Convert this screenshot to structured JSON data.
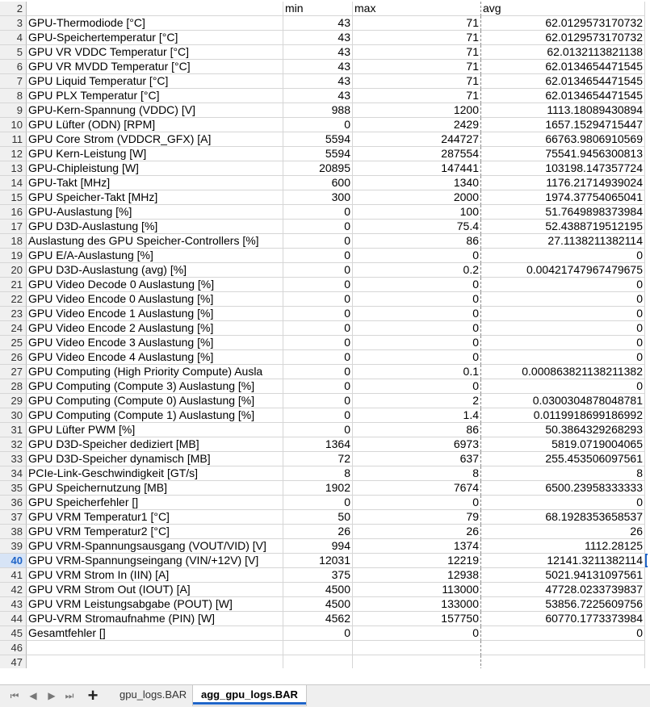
{
  "header_row": {
    "row": "2",
    "a": "",
    "b": "min",
    "c": "max",
    "d": "avg"
  },
  "rows": [
    {
      "row": "3",
      "name": "GPU-Thermodiode [°C]",
      "min": "43",
      "max": "71",
      "avg": "62.0129573170732"
    },
    {
      "row": "4",
      "name": "GPU-Speichertemperatur [°C]",
      "min": "43",
      "max": "71",
      "avg": "62.0129573170732"
    },
    {
      "row": "5",
      "name": "GPU VR VDDC Temperatur [°C]",
      "min": "43",
      "max": "71",
      "avg": "62.0132113821138"
    },
    {
      "row": "6",
      "name": "GPU VR MVDD Temperatur [°C]",
      "min": "43",
      "max": "71",
      "avg": "62.0134654471545"
    },
    {
      "row": "7",
      "name": "GPU Liquid Temperatur [°C]",
      "min": "43",
      "max": "71",
      "avg": "62.0134654471545"
    },
    {
      "row": "8",
      "name": "GPU PLX Temperatur [°C]",
      "min": "43",
      "max": "71",
      "avg": "62.0134654471545"
    },
    {
      "row": "9",
      "name": "GPU-Kern-Spannung (VDDC) [V]",
      "min": "988",
      "max": "1200",
      "avg": "1113.18089430894"
    },
    {
      "row": "10",
      "name": "GPU Lüfter (ODN) [RPM]",
      "min": "0",
      "max": "2429",
      "avg": "1657.15294715447"
    },
    {
      "row": "11",
      "name": "GPU Core Strom (VDDCR_GFX) [A]",
      "min": "5594",
      "max": "244727",
      "avg": "66763.9806910569"
    },
    {
      "row": "12",
      "name": "GPU Kern-Leistung [W]",
      "min": "5594",
      "max": "287554",
      "avg": "75541.9456300813"
    },
    {
      "row": "13",
      "name": "GPU-Chipleistung [W]",
      "min": "20895",
      "max": "147441",
      "avg": "103198.147357724"
    },
    {
      "row": "14",
      "name": "GPU-Takt [MHz]",
      "min": "600",
      "max": "1340",
      "avg": "1176.21714939024"
    },
    {
      "row": "15",
      "name": "GPU Speicher-Takt [MHz]",
      "min": "300",
      "max": "2000",
      "avg": "1974.37754065041"
    },
    {
      "row": "16",
      "name": "GPU-Auslastung [%]",
      "min": "0",
      "max": "100",
      "avg": "51.7649898373984"
    },
    {
      "row": "17",
      "name": "GPU D3D-Auslastung [%]",
      "min": "0",
      "max": "75.4",
      "avg": "52.4388719512195"
    },
    {
      "row": "18",
      "name": "Auslastung des GPU Speicher-Controllers [%]",
      "min": "0",
      "max": "86",
      "avg": "27.1138211382114"
    },
    {
      "row": "19",
      "name": "GPU E/A-Auslastung [%]",
      "min": "0",
      "max": "0",
      "avg": "0"
    },
    {
      "row": "20",
      "name": "GPU D3D-Auslastung (avg) [%]",
      "min": "0",
      "max": "0.2",
      "avg": "0.00421747967479675"
    },
    {
      "row": "21",
      "name": "GPU Video Decode 0 Auslastung [%]",
      "min": "0",
      "max": "0",
      "avg": "0"
    },
    {
      "row": "22",
      "name": "GPU Video Encode 0 Auslastung [%]",
      "min": "0",
      "max": "0",
      "avg": "0"
    },
    {
      "row": "23",
      "name": "GPU Video Encode 1 Auslastung [%]",
      "min": "0",
      "max": "0",
      "avg": "0"
    },
    {
      "row": "24",
      "name": "GPU Video Encode 2 Auslastung [%]",
      "min": "0",
      "max": "0",
      "avg": "0"
    },
    {
      "row": "25",
      "name": "GPU Video Encode 3 Auslastung [%]",
      "min": "0",
      "max": "0",
      "avg": "0"
    },
    {
      "row": "26",
      "name": "GPU Video Encode 4 Auslastung [%]",
      "min": "0",
      "max": "0",
      "avg": "0"
    },
    {
      "row": "27",
      "name": "GPU Computing (High Priority Compute) Ausla",
      "min": "0",
      "max": "0.1",
      "avg": "0.000863821138211382"
    },
    {
      "row": "28",
      "name": "GPU Computing (Compute 3) Auslastung [%]",
      "min": "0",
      "max": "0",
      "avg": "0"
    },
    {
      "row": "29",
      "name": "GPU Computing (Compute 0) Auslastung [%]",
      "min": "0",
      "max": "2",
      "avg": "0.0300304878048781"
    },
    {
      "row": "30",
      "name": "GPU Computing (Compute 1) Auslastung [%]",
      "min": "0",
      "max": "1.4",
      "avg": "0.0119918699186992"
    },
    {
      "row": "31",
      "name": "GPU Lüfter PWM [%]",
      "min": "0",
      "max": "86",
      "avg": "50.3864329268293"
    },
    {
      "row": "32",
      "name": "GPU D3D-Speicher dediziert [MB]",
      "min": "1364",
      "max": "6973",
      "avg": "5819.0719004065"
    },
    {
      "row": "33",
      "name": "GPU D3D-Speicher dynamisch [MB]",
      "min": "72",
      "max": "637",
      "avg": "255.453506097561"
    },
    {
      "row": "34",
      "name": "PCIe-Link-Geschwindigkeit [GT/s]",
      "min": "8",
      "max": "8",
      "avg": "8"
    },
    {
      "row": "35",
      "name": "GPU Speichernutzung [MB]",
      "min": "1902",
      "max": "7674",
      "avg": "6500.23958333333"
    },
    {
      "row": "36",
      "name": "GPU Speicherfehler []",
      "min": "0",
      "max": "0",
      "avg": "0"
    },
    {
      "row": "37",
      "name": "GPU VRM Temperatur1 [°C]",
      "min": "50",
      "max": "79",
      "avg": "68.1928353658537"
    },
    {
      "row": "38",
      "name": "GPU VRM Temperatur2 [°C]",
      "min": "26",
      "max": "26",
      "avg": "26"
    },
    {
      "row": "39",
      "name": "GPU VRM-Spannungsausgang (VOUT/VID) [V]",
      "min": "994",
      "max": "1374",
      "avg": "1112.28125"
    },
    {
      "row": "40",
      "name": "GPU VRM-Spannungseingang (VIN/+12V) [V]",
      "min": "12031",
      "max": "12219",
      "avg": "12141.3211382114"
    },
    {
      "row": "41",
      "name": "GPU VRM Strom In (IIN) [A]",
      "min": "375",
      "max": "12938",
      "avg": "5021.94131097561"
    },
    {
      "row": "42",
      "name": "GPU VRM Strom Out (IOUT) [A]",
      "min": "4500",
      "max": "113000",
      "avg": "47728.0233739837"
    },
    {
      "row": "43",
      "name": "GPU VRM Leistungsabgabe (POUT) [W]",
      "min": "4500",
      "max": "133000",
      "avg": "53856.7225609756"
    },
    {
      "row": "44",
      "name": "GPU-VRM Stromaufnahme (PIN) [W]",
      "min": "4562",
      "max": "157750",
      "avg": "60770.1773373984"
    },
    {
      "row": "45",
      "name": "Gesamtfehler []",
      "min": "0",
      "max": "0",
      "avg": "0"
    },
    {
      "row": "46",
      "name": "",
      "min": "",
      "max": "",
      "avg": ""
    },
    {
      "row": "47",
      "name": "",
      "min": "",
      "max": "",
      "avg": ""
    }
  ],
  "active_row": "40",
  "sheet_tabs": {
    "inactive_label": "gpu_logs.BAR",
    "active_label": "agg_gpu_logs.BAR"
  },
  "nav_icons": [
    "first-sheet-icon",
    "prev-sheet-icon",
    "next-sheet-icon",
    "last-sheet-icon",
    "add-sheet-icon"
  ],
  "colors": {
    "accent": "#1e64c8",
    "grid": "#d6d6d6",
    "header_bg": "#f0f0f0"
  }
}
